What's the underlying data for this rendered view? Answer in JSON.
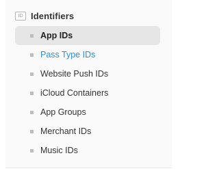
{
  "section": {
    "icon": "id-card-icon",
    "icon_text": "ID",
    "title": "Identifiers"
  },
  "items": [
    {
      "label": "App IDs",
      "state": "selected"
    },
    {
      "label": "Pass Type IDs",
      "state": "link"
    },
    {
      "label": "Website Push IDs",
      "state": "default"
    },
    {
      "label": "iCloud Containers",
      "state": "default"
    },
    {
      "label": "App Groups",
      "state": "default"
    },
    {
      "label": "Merchant IDs",
      "state": "default"
    },
    {
      "label": "Music IDs",
      "state": "default"
    }
  ],
  "colors": {
    "link": "#2a8fd0",
    "selected_bg": "#e6e6e6",
    "bullet": "#bdbdbd",
    "text": "#333333"
  }
}
